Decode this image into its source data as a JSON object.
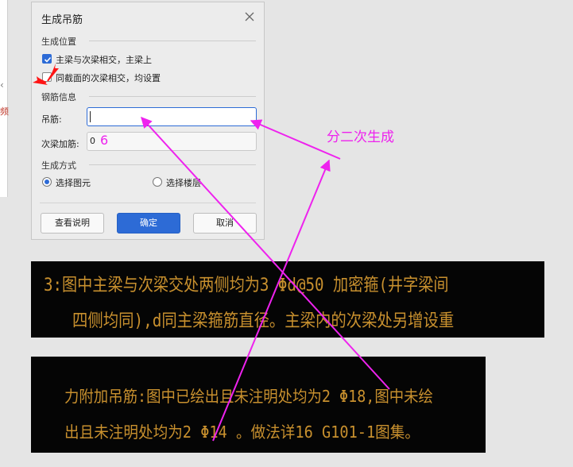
{
  "left_panel": {
    "char": "频"
  },
  "dialog": {
    "title": "生成吊筋",
    "section_position": "生成位置",
    "option_main_secondary": "主梁与次梁相交，主梁上",
    "option_same_section": "同截面的次梁相交，均设置",
    "section_rebar": "钢筋信息",
    "label_hanger": "吊筋:",
    "hanger_value": "",
    "label_secondary_rebar": "次梁加筋:",
    "secondary_rebar_value": "0",
    "section_method": "生成方式",
    "radio_select_element": "选择图元",
    "radio_select_floor": "选择楼层",
    "btn_help": "查看说明",
    "btn_ok": "确定",
    "btn_cancel": "取消"
  },
  "annotation": {
    "text": "分二次生成",
    "handwritten_digit": "6",
    "color": "#ee22ee"
  },
  "cad_notes": {
    "line1": "3:图中主梁与次梁交处两侧均为3 Φd@50 加密箍(井字梁间",
    "line2": "四侧均同),d同主梁箍筋直径。主梁内的次梁处另增设重",
    "line3": "力附加吊筋:图中已绘出且未注明处均为2 Φ18,图中未绘",
    "line4": "出且未注明处均为2 Φ14 。做法详16 G101-1图集。",
    "text_color": "#c8902e"
  }
}
